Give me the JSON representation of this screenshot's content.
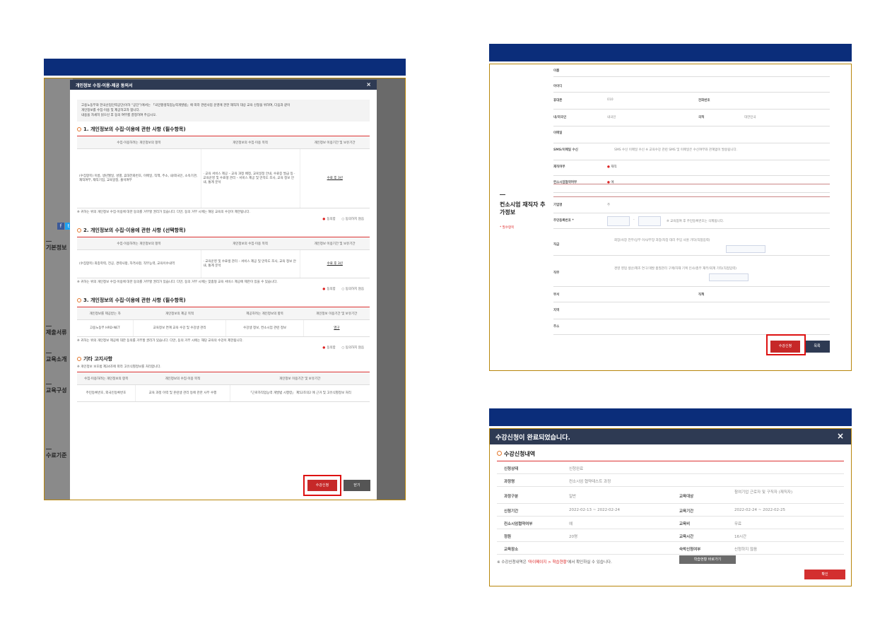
{
  "left_panel": {
    "modal_title": "개인정보 수집·이용·제공 동의서",
    "close": "×",
    "intro": [
      "고용노동부와 한국산업인력공단(이하 “공단”)에서는 「국민평생직업능력개발법」에 따라 관련사업 운영에 관한 재직자 대상 교육 신청을 위하여, 다음과 같이",
      "개인정보를 수집·이용 및 제공하고자 합니다.",
      "내용을 자세히 읽으신 후 동의 여부를 결정하여 주십시오."
    ],
    "sec1": "1. 개인정보의 수집·이용에 관한 사항 (필수항목)",
    "sec1_head": [
      "수집·이용하려는 개인정보의 항목",
      "개인정보의 수집·이용 목적",
      "개인정보 이용기간 및 보유기간"
    ],
    "sec1_row": [
      "(수집항목) 이름, 생년월일, 성별, 휴대전화번호, 이메일, 직책, 주소, 내/외국인, 소속기관, 재직여부, 재직기업, 교육일정, 출석여부",
      "· 교육 서비스 제공 – 교육 과정 배정, 교육일정 안내, 수료증 발급 등 · 교육운영 및 수료생 관리 – 서비스 제공 및 만족도 조사, 교육 정보 안내, 통계 분석",
      "수료 후 3년"
    ],
    "sec1_note": "※ 귀하는 위의 개인정보 수집·이용에 대한 동의를 거부할 권리가 있습니다. 다만, 동의 거부 시에는 해당 교육의 수강이 제한됩니다.",
    "agree": "동의함",
    "disagree": "동의하지 않음",
    "sec2": "2. 개인정보의 수집·이용에 관한 사항 (선택항목)",
    "sec2_head": [
      "수집·이용하려는 개인정보의 항목",
      "개인정보의 수집·이용 목적",
      "개인정보 이용기간 및 보유기간"
    ],
    "sec2_row": [
      "(수집항목) 최종학력, 전공, 경력사항, 자격사항, 직무능력, 교육이수내역",
      "· 교육운영 및 수료생 관리 – 서비스 제공 및 만족도 조사, 교육 정보 안내, 통계 분석",
      "수료 후 3년"
    ],
    "sec2_note": "※ 귀하는 위의 개인정보 수집·이용에 대한 동의를 거부할 권리가 있습니다. 다만, 동의 거부 시에는 맞춤형 교육 서비스 제공에 제한이 있을 수 있습니다.",
    "sec3": "3. 개인정보의 수집·이용에 관한 사항 (필수항목)",
    "sec3_head": [
      "개인정보를 제공받는 자",
      "개인정보의 제공 목적",
      "제공하려는 개인정보의 항목",
      "개인정보 이용기간 및 보유기간"
    ],
    "sec3_row": [
      "고용노동부 HRD-NET",
      "교육정보 연계 교육 수강 및 수강생 관리",
      "수강생 정보, 컨소시엄 관련 정보",
      "영구"
    ],
    "sec3_note": "※ 귀하는 위의 개인정보 제공에 대한 동의를 거부할 권리가 있습니다. 다만, 동의 거부 시에는 해당 교육의 수강이 제한됩니다.",
    "sec4": "기타 고지사항",
    "sec4_sub": "※ 개인정보 보호법 제24조에 따라 고유식별정보를 처리합니다.",
    "sec4_head": [
      "수집·이용하려는 개인정보의 항목",
      "개인정보의 수집·이용 목적",
      "개인정보 이용기간 및 보유기간"
    ],
    "sec4_row": [
      "주민등록번호, 외국인등록번호",
      "교육 과정 이력 및 훈련생 관리 등에 관한 사무 수행",
      "「근로자직업능력 개발법 시행령」 제52조의2 에 근거 및 고유식별정보 처리"
    ],
    "btn_apply": "수강신청",
    "btn_close": "닫기",
    "side": [
      "기본정보",
      "제출서류",
      "교육소개",
      "교육구성",
      "수료기준"
    ],
    "share_icons": [
      "f",
      "t"
    ]
  },
  "right_top": {
    "fields": [
      {
        "label": "이름",
        "value": ""
      },
      {
        "label": "아이디",
        "value": ""
      },
      {
        "label": "휴대폰",
        "value": "010",
        "label2": "전화번호",
        "value2": ""
      },
      {
        "label": "내/외국인",
        "value": "내국인",
        "label2": "국적",
        "value2": "대한민국"
      },
      {
        "label": "이메일",
        "value": ""
      },
      {
        "label": "SMS/이메일 수신",
        "value": "SMS 수신    이메일 수신    ※ 교육수강 관련 SMS 및 이메일은 수신여부와 관계없이 발송됩니다."
      },
      {
        "label": "재직여부",
        "value": "재직"
      },
      {
        "label": "컨소시엄협약여부",
        "value": "예"
      }
    ],
    "section_title": "컨소시엄 재직자 추가정보",
    "required": "* 필수항목",
    "fields2": [
      {
        "label": "기업명",
        "value": "주"
      },
      {
        "label": "주민등록번호 *",
        "value": "※ 교육참여 후 주민등록번호는 삭제됩니다."
      },
      {
        "label": "직급",
        "value": "회장/사장    전무/상무    이사/부장    과장/차장    대리    주임    사원    기타(직접입력)"
      },
      {
        "label": "직무",
        "value": "경영    영업    생산/제조    연구/개발    품질관리    구매/자재    기획    인사/총무    재무/회계    기타(직접입력)"
      },
      {
        "label": "부서",
        "value": "",
        "label2": "직책",
        "value2": ""
      },
      {
        "label": "지역",
        "value": ""
      },
      {
        "label": "주소",
        "value": ""
      }
    ],
    "btn_apply": "수강신청",
    "btn_list": "목록"
  },
  "right_bottom": {
    "title": "수강신청이 완료되었습니다.",
    "close": "×",
    "section": "수강신청내역",
    "rows": [
      {
        "k": "신청상태",
        "v": "신청완료"
      },
      {
        "k": "과정명",
        "v": "컨소시엄 협약테스트 과정"
      },
      {
        "k": "과정구분",
        "v": "일반",
        "k2": "교육대상",
        "v2": "참여기업 근로자 및 구직자 (재직자)"
      },
      {
        "k": "신청기간",
        "v": "2022-02-13 ~ 2022-02-24",
        "k2": "교육기간",
        "v2": "2022-02-24 ~ 2022-02-25"
      },
      {
        "k": "컨소시엄협약여부",
        "v": "예",
        "k2": "교육비",
        "v2": "무료"
      },
      {
        "k": "정원",
        "v": "20명",
        "k2": "교육시간",
        "v2": "16시간"
      },
      {
        "k": "교육장소",
        "v": "",
        "k2": "숙박신청여부",
        "v2": "신청하지 않음"
      }
    ],
    "note_pre": "※ 수강신청내역은 ",
    "note_link": "'마이페이지 > 학습현황'",
    "note_post": "에서 확인하실 수 있습니다.",
    "btn_status": "학습현황 바로가기",
    "btn_ok": "확인"
  },
  "colors": {
    "navy": "#0b2d7a",
    "red": "#c62828",
    "gold": "#b8860b"
  }
}
